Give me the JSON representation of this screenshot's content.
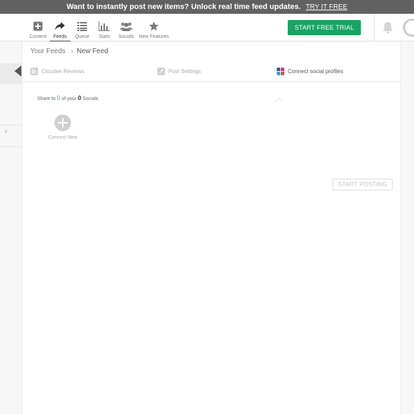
{
  "banner": {
    "text": "Want to instantly post new items? Unlock real time feed updates.",
    "cta": "TRY IT FREE"
  },
  "nav": {
    "items": [
      {
        "label": "Content",
        "icon": "plus-square-icon"
      },
      {
        "label": "Feeds",
        "icon": "share-arrow-icon",
        "active": true
      },
      {
        "label": "Queue",
        "icon": "list-icon"
      },
      {
        "label": "Stats",
        "icon": "bar-chart-icon"
      },
      {
        "label": "Socials",
        "icon": "users-icon"
      },
      {
        "label": "New Features",
        "icon": "star-icon"
      }
    ]
  },
  "header": {
    "trial_button": "START FREE TRIAL"
  },
  "breadcrumb": {
    "parent": "Your Feeds",
    "current": "New Feed"
  },
  "tabs": [
    {
      "label": "Cloudee Reviews",
      "icon": "rss-icon"
    },
    {
      "label": "Post Settings",
      "icon": "settings-icon"
    },
    {
      "label": "Connect social profiles",
      "icon": "social-grid-icon",
      "active": true
    }
  ],
  "share": {
    "prefix": "Share to",
    "selected": "0",
    "middle": "of your",
    "total": "0",
    "suffix": "Socials"
  },
  "connect": {
    "label": "Connect New"
  },
  "actions": {
    "start_posting": "START POSTING"
  },
  "rail": {
    "marker": "0"
  },
  "colors": {
    "accent_green": "#1aa364",
    "link_blue": "#29a8e0",
    "banner_bg": "#616161"
  }
}
